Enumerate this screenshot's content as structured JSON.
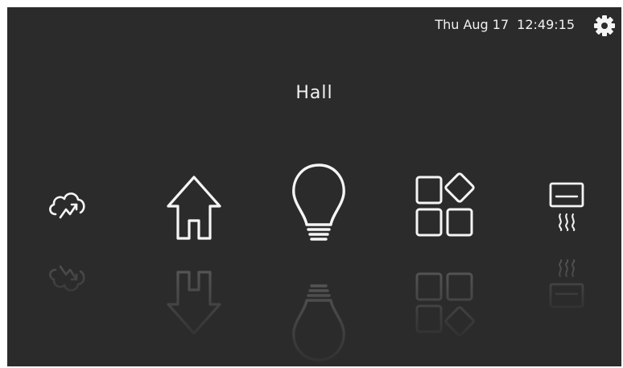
{
  "header": {
    "date": "Thu Aug 17",
    "time": "12:49:15",
    "settings_icon": "gear-icon"
  },
  "room": {
    "title": "Hall"
  },
  "carousel": {
    "items": [
      {
        "icon": "weather-icon"
      },
      {
        "icon": "home-icon"
      },
      {
        "icon": "light-bulb-icon",
        "selected": true
      },
      {
        "icon": "apps-icon"
      },
      {
        "icon": "heater-icon"
      }
    ]
  },
  "colors": {
    "background": "#2b2b2b",
    "foreground": "#f5f5f5"
  }
}
